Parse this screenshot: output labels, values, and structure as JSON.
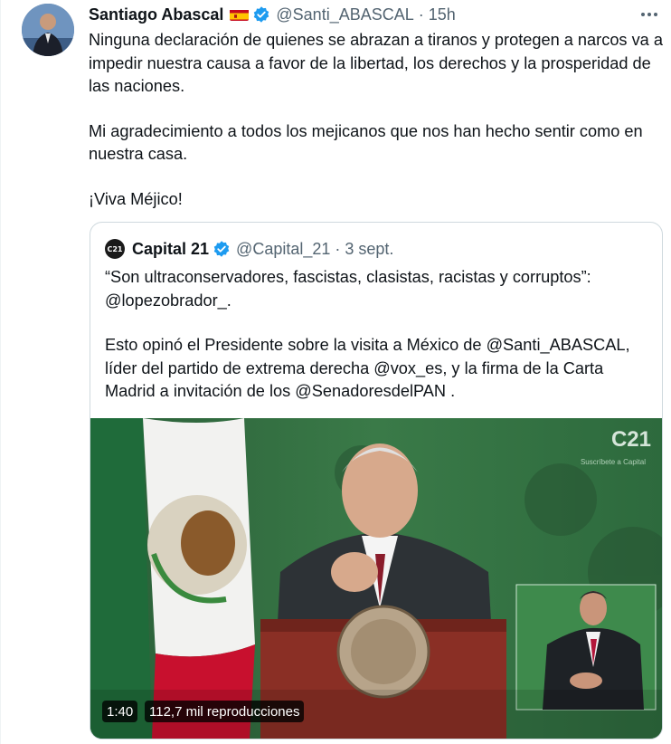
{
  "tweet": {
    "author_name": "Santiago Abascal",
    "author_flag_icon": "spain-flag-icon",
    "handle": "@Santi_ABASCAL",
    "separator": "·",
    "time": "15h",
    "paragraphs": [
      "Ninguna declaración de quienes se abrazan a tiranos y protegen a narcos va a impedir nuestra causa a favor de la libertad, los derechos y la prosperidad de las naciones.",
      "Mi agradecimiento a todos los mejicanos que nos han hecho sentir como en nuestra casa.",
      "¡Viva Méjico!"
    ]
  },
  "quoted": {
    "avatar_text": "C21",
    "name": "Capital 21",
    "handle": "@Capital_21",
    "separator": "·",
    "date": "3 sept.",
    "paragraphs": [
      "“Son ultraconservadores, fascistas, clasistas, racistas y corruptos”: @lopezobrador_.",
      "Esto opinó el Presidente sobre la visita a México de @Santi_ABASCAL, líder del partido de extrema derecha @vox_es, y la firma de la Carta Madrid a invitación de los @SenadoresdelPAN ."
    ],
    "video": {
      "duration": "1:40",
      "views": "112,7 mil reproducciones",
      "watermark": "C21",
      "watermark_sub": "Suscríbete a Capital"
    }
  },
  "colors": {
    "text": "#0f1419",
    "secondary": "#536471",
    "verified": "#1d9bf0",
    "border": "#cfd9de",
    "video_bg": "#2f6a3e"
  }
}
